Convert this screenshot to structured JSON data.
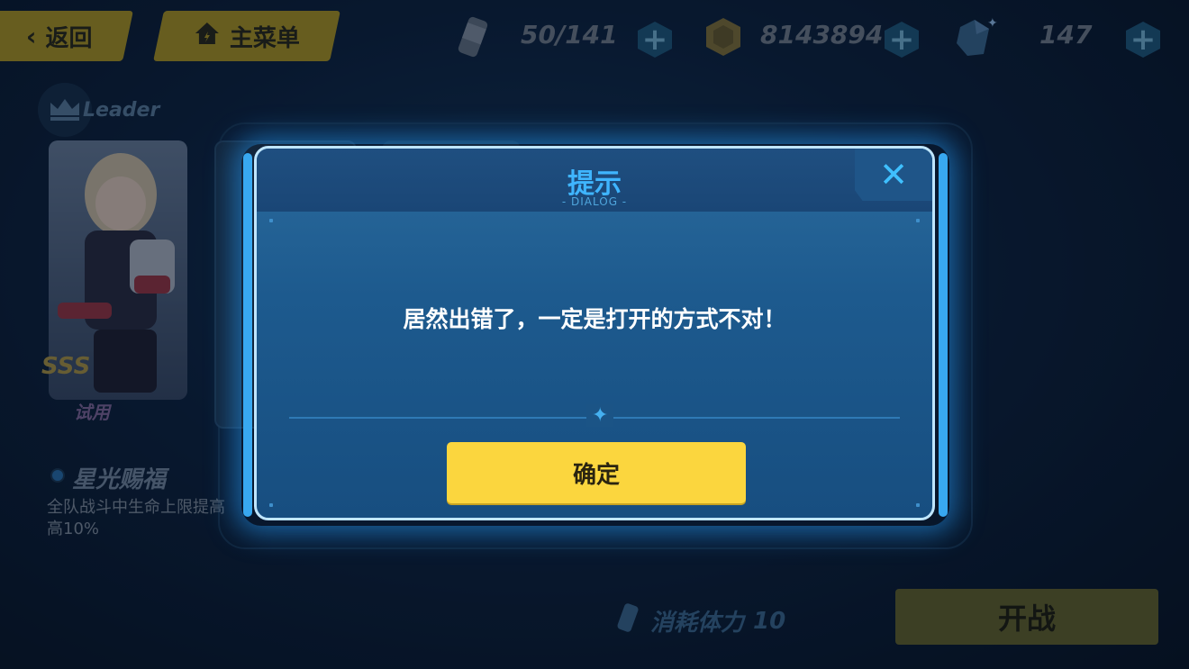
{
  "topbar": {
    "back_label": "返回",
    "menu_label": "主菜单",
    "stamina": "50/141",
    "coins": "8143894",
    "crystals": "147",
    "plus_glyph": "+"
  },
  "team": {
    "leader_label": "Leader",
    "rank_badge": "SSS",
    "trial_label": "试用",
    "skill_name": "星光赐福",
    "skill_desc_line1": "全队战斗中生命上限提高",
    "skill_desc_line2": "高10%"
  },
  "bottom": {
    "cost_label": "消耗体力",
    "cost_value": "10",
    "start_label": "开战"
  },
  "dialog": {
    "title": "提示",
    "subtitle": "- DIALOG -",
    "close_glyph": "✕",
    "message": "居然出错了，一定是打开的方式不对！",
    "confirm_label": "确定",
    "divider_glyph": "✦"
  },
  "colors": {
    "accent_yellow": "#fbd63e",
    "dialog_blue": "#1d5a8e",
    "title_blue": "#3fb5ff"
  }
}
